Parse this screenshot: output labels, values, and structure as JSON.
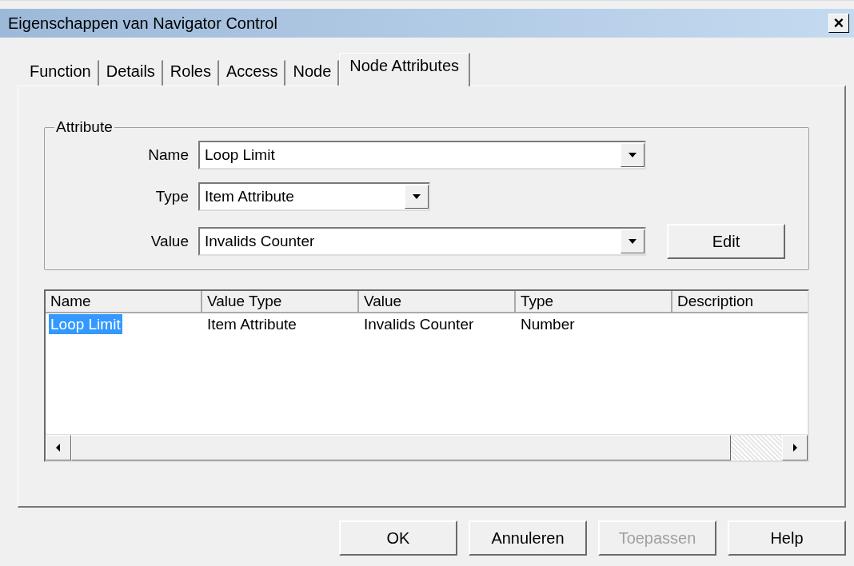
{
  "window": {
    "title": "Eigenschappen van Navigator Control",
    "close": "×"
  },
  "tabs": [
    {
      "label": "Function",
      "selected": false
    },
    {
      "label": "Details",
      "selected": false
    },
    {
      "label": "Roles",
      "selected": false
    },
    {
      "label": "Access",
      "selected": false
    },
    {
      "label": "Node",
      "selected": false
    },
    {
      "label": "Node Attributes",
      "selected": true
    }
  ],
  "attribute_group": {
    "legend": "Attribute",
    "fields": [
      {
        "label": "Name",
        "value": "Loop Limit"
      },
      {
        "label": "Type",
        "value": "Item Attribute"
      },
      {
        "label": "Value",
        "value": "Invalids Counter"
      }
    ],
    "edit_button": "Edit"
  },
  "table": {
    "columns": [
      "Name",
      "Value Type",
      "Value",
      "Type",
      "Description"
    ],
    "rows": [
      {
        "cells": [
          "Loop Limit",
          "Item Attribute",
          "Invalids Counter",
          "Number",
          ""
        ],
        "selected": true
      }
    ]
  },
  "buttons": [
    {
      "label": "OK",
      "disabled": false
    },
    {
      "label": "Annuleren",
      "disabled": false
    },
    {
      "label": "Toepassen",
      "disabled": true
    },
    {
      "label": "Help",
      "disabled": false
    }
  ]
}
